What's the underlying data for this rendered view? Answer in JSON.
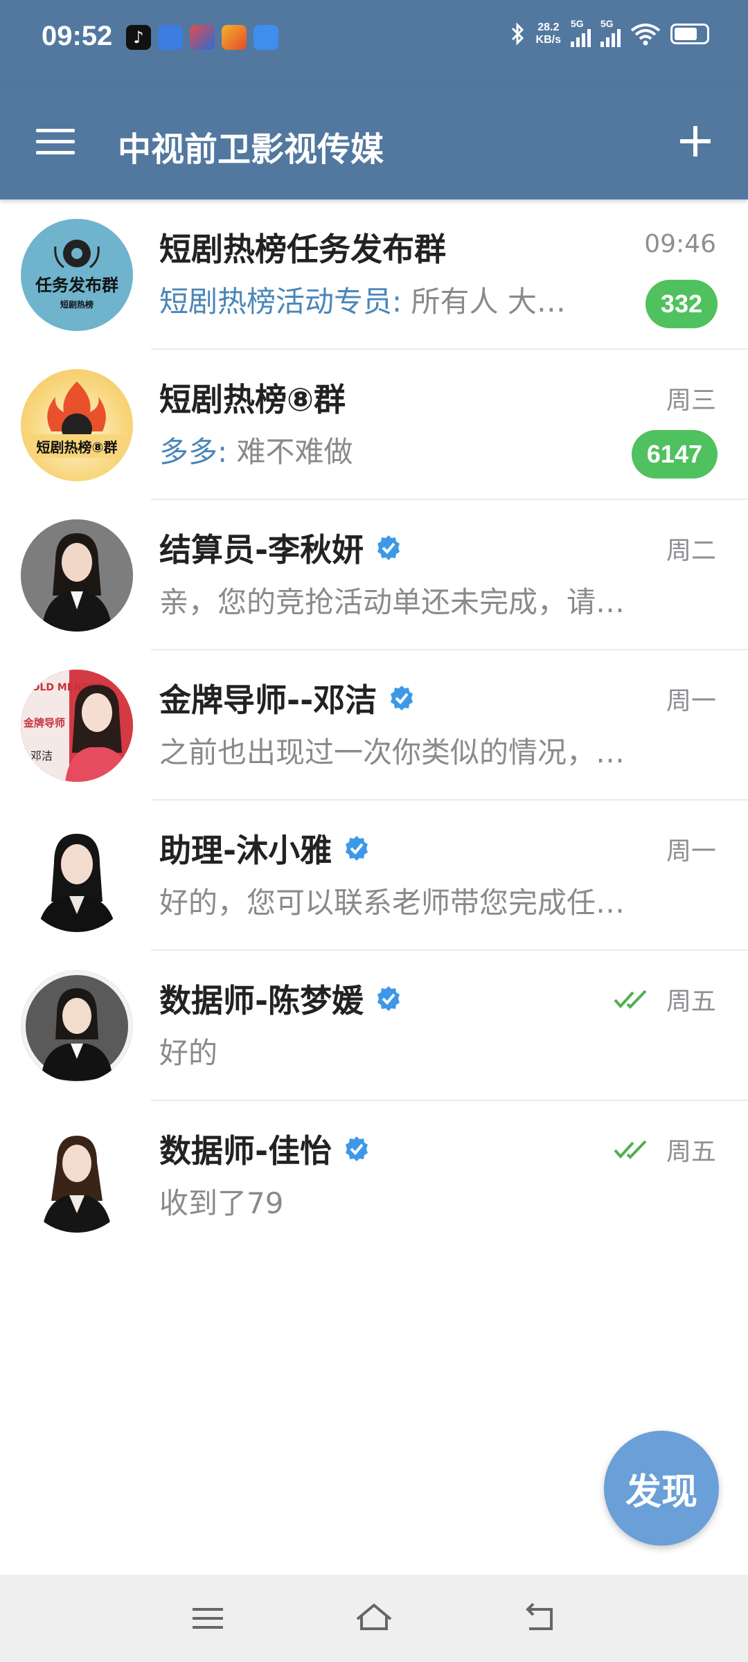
{
  "status_bar": {
    "time": "09:52",
    "network_speed_value": "28.2",
    "network_speed_unit": "KB/s",
    "signal1_label": "5G",
    "signal2_label": "5G",
    "battery_level": 0.75,
    "app_icons": [
      "douyin-icon",
      "baidu-map-icon",
      "video-app-icon",
      "game-app-icon",
      "browser-icon"
    ]
  },
  "app_bar": {
    "title": "中视前卫影视传媒"
  },
  "chats": [
    {
      "avatar_text": "任务发布群",
      "avatar_subtext": "短剧热榜",
      "name": "短剧热榜任务发布群",
      "time": "09:46",
      "sender": "短剧热榜活动专员",
      "message": "所有人 大…",
      "unread": "332"
    },
    {
      "avatar_text": "短剧热榜⑧群",
      "name": "短剧热榜⑧群",
      "time": "周三",
      "sender": "多多",
      "message": "难不难做",
      "unread": "6147"
    },
    {
      "name": "结算员-李秋妍",
      "time": "周二",
      "message": "亲，您的竞抢活动单还未完成，请…"
    },
    {
      "avatar_text_top": "GOLD MENTOR",
      "avatar_text_mid": "金牌导师",
      "avatar_text_bottom": "邓洁",
      "name": "金牌导师--邓洁",
      "time": "周一",
      "message": "之前也出现过一次你类似的情况，…"
    },
    {
      "name": "助理-沐小雅",
      "time": "周一",
      "message": "好的，您可以联系老师带您完成任…"
    },
    {
      "name": "数据师-陈梦媛",
      "time": "周五",
      "message": "好的"
    },
    {
      "name": "数据师-佳怡",
      "time": "周五",
      "message": "收到了79"
    }
  ],
  "fab_label": "发现",
  "colors": {
    "primary": "#5278a0",
    "badge": "#4fc15e",
    "sender": "#4a86b8",
    "fab": "#6a9fd8",
    "read_check": "#4fb04f"
  }
}
